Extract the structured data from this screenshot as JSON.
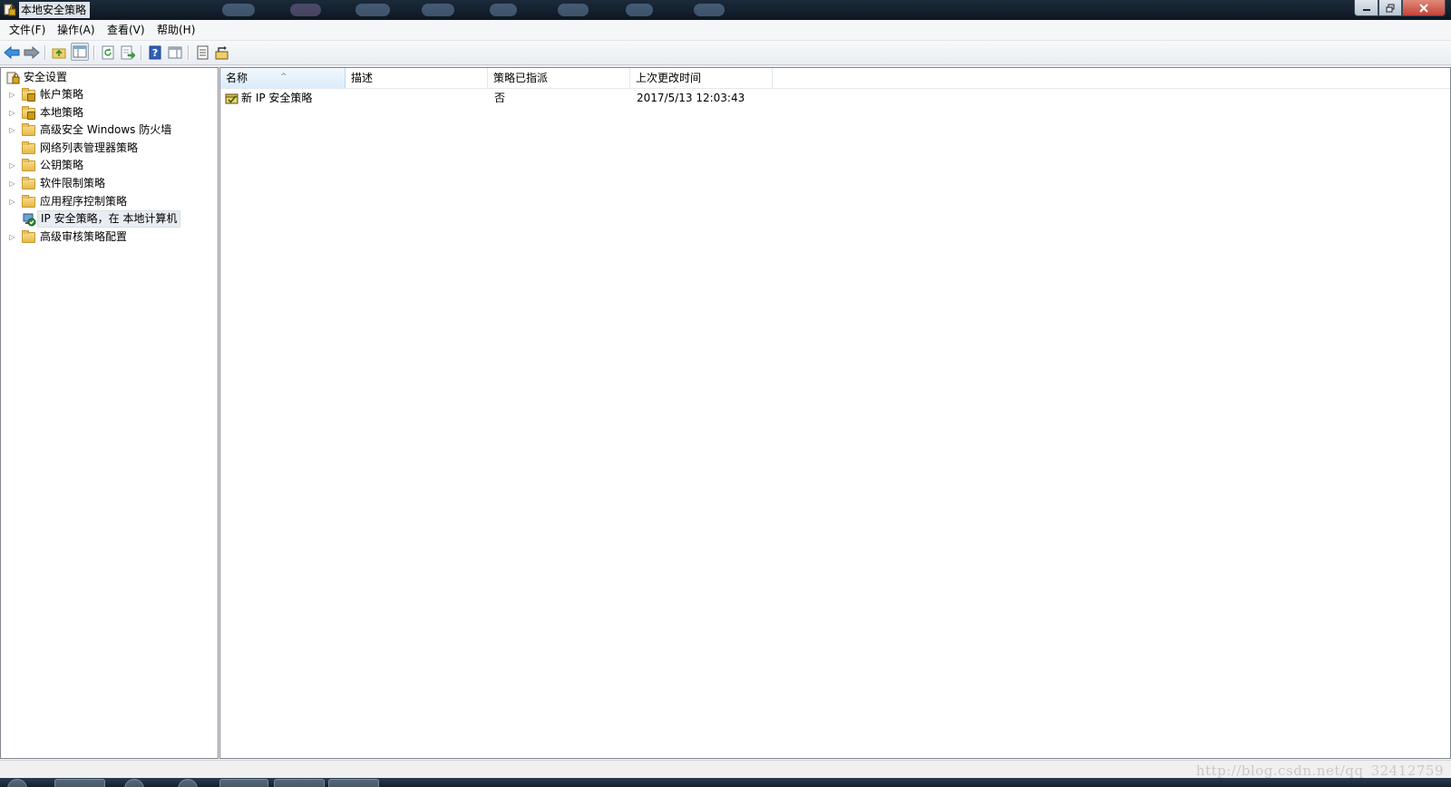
{
  "window": {
    "title": "本地安全策略"
  },
  "menubar": {
    "items": [
      {
        "label": "文件(F)"
      },
      {
        "label": "操作(A)"
      },
      {
        "label": "查看(V)"
      },
      {
        "label": "帮助(H)"
      }
    ]
  },
  "toolbar": {
    "buttons": [
      {
        "icon": "back-arrow-icon"
      },
      {
        "icon": "forward-arrow-icon"
      },
      {
        "icon": "up-folder-icon"
      },
      {
        "icon": "show-hide-console-tree-icon"
      },
      {
        "icon": "refresh-icon"
      },
      {
        "icon": "export-list-icon"
      },
      {
        "icon": "help-icon"
      },
      {
        "icon": "action-pane-icon"
      },
      {
        "icon": "properties-icon"
      },
      {
        "icon": "assign-policy-icon"
      }
    ]
  },
  "tree": {
    "root": {
      "label": "安全设置",
      "icon": "security-settings-icon"
    },
    "items": [
      {
        "label": "帐户策略",
        "icon": "locked-folder-icon",
        "expandable": true
      },
      {
        "label": "本地策略",
        "icon": "locked-folder-icon",
        "expandable": true
      },
      {
        "label": "高级安全 Windows 防火墙",
        "icon": "folder-icon",
        "expandable": true
      },
      {
        "label": "网络列表管理器策略",
        "icon": "folder-icon",
        "expandable": false
      },
      {
        "label": "公钥策略",
        "icon": "folder-icon",
        "expandable": true
      },
      {
        "label": "软件限制策略",
        "icon": "folder-icon",
        "expandable": true
      },
      {
        "label": "应用程序控制策略",
        "icon": "folder-icon",
        "expandable": true
      },
      {
        "label": "IP 安全策略，在 本地计算机",
        "icon": "ip-security-icon",
        "expandable": false,
        "selected": true
      },
      {
        "label": "高级审核策略配置",
        "icon": "folder-icon",
        "expandable": true
      }
    ]
  },
  "list": {
    "columns": [
      {
        "label": "名称",
        "sorted": true
      },
      {
        "label": "描述"
      },
      {
        "label": "策略已指派"
      },
      {
        "label": "上次更改时间"
      }
    ],
    "rows": [
      {
        "name": "新 IP 安全策略",
        "description": "",
        "assigned": "否",
        "modified": "2017/5/13 12:03:43",
        "icon": "ip-policy-icon"
      }
    ]
  },
  "statusbar": {
    "watermark": "http://blog.csdn.net/qq_32412759"
  },
  "colors": {
    "title_bar": "#14202e",
    "selection": "#e8edf3",
    "sorted_header": "#dcecfc"
  }
}
